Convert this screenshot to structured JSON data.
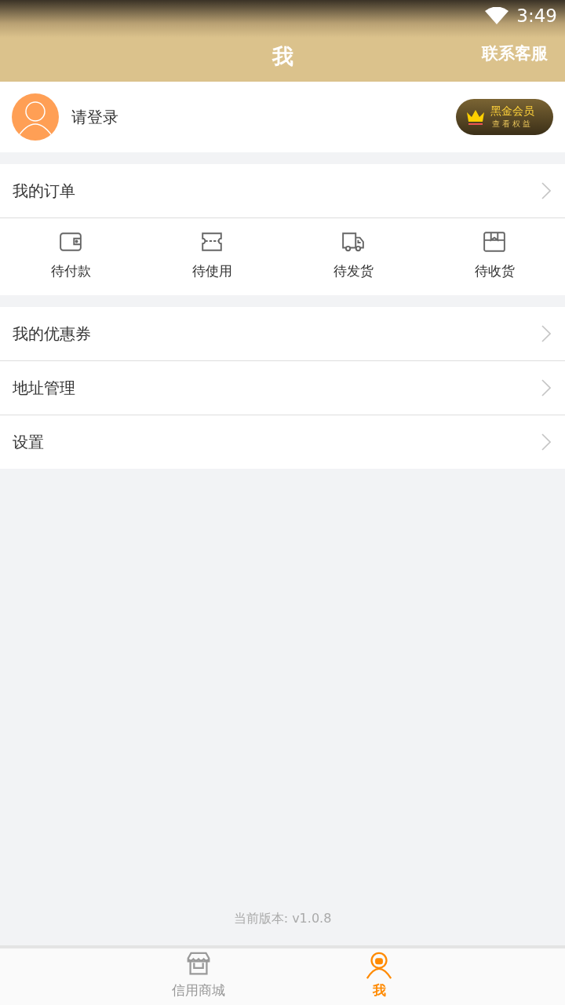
{
  "status_bar": {
    "time": "3:49"
  },
  "header": {
    "title": "我",
    "action": "联系客服"
  },
  "profile": {
    "login_prompt": "请登录",
    "vip_badge": {
      "title": "黑金会员",
      "subtitle": "查看权益"
    }
  },
  "orders": {
    "title": "我的订单",
    "items": [
      {
        "kind": "wallet",
        "label": "待付款"
      },
      {
        "kind": "ticket",
        "label": "待使用"
      },
      {
        "kind": "truck",
        "label": "待发货"
      },
      {
        "kind": "box",
        "label": "待收货"
      }
    ]
  },
  "menu": [
    {
      "label": "我的优惠券"
    },
    {
      "label": "地址管理"
    },
    {
      "label": "设置"
    }
  ],
  "version": "当前版本: v1.0.8",
  "tab_bar": [
    {
      "kind": "store",
      "label": "信用商城",
      "selected": false
    },
    {
      "kind": "person",
      "label": "我",
      "selected": true
    }
  ]
}
